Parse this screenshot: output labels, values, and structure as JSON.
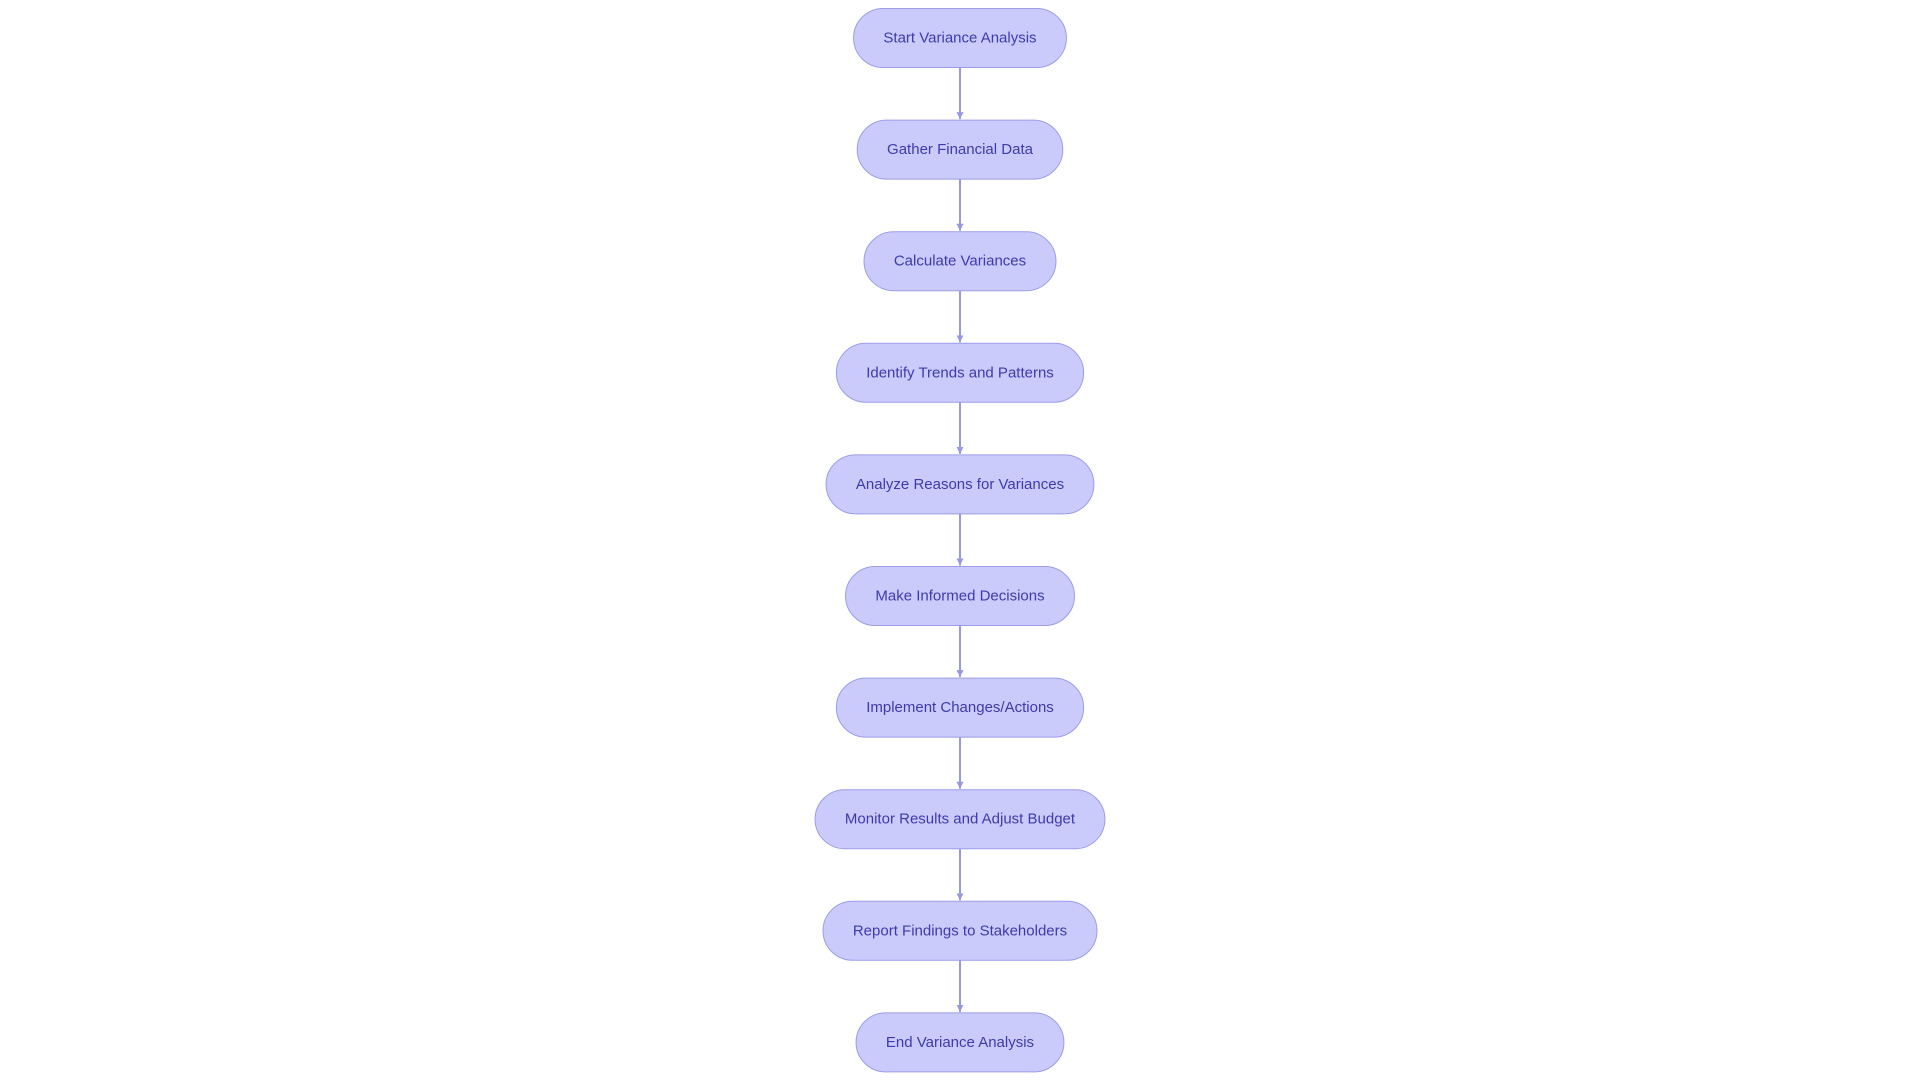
{
  "diagram": {
    "type": "flowchart",
    "direction": "top-to-bottom",
    "colors": {
      "node_fill": "#cbcbfb",
      "node_stroke": "#9c9ce8",
      "node_text": "#3b3bab",
      "edge": "#9797e6",
      "background": "#ffffff"
    },
    "nodes": [
      {
        "id": "start",
        "label": "Start Variance Analysis",
        "shape": "stadium"
      },
      {
        "id": "gather",
        "label": "Gather Financial Data",
        "shape": "stadium"
      },
      {
        "id": "calculate",
        "label": "Calculate Variances",
        "shape": "stadium"
      },
      {
        "id": "identify",
        "label": "Identify Trends and Patterns",
        "shape": "stadium"
      },
      {
        "id": "analyze",
        "label": "Analyze Reasons for Variances",
        "shape": "stadium"
      },
      {
        "id": "decide",
        "label": "Make Informed Decisions",
        "shape": "stadium"
      },
      {
        "id": "implement",
        "label": "Implement Changes/Actions",
        "shape": "stadium"
      },
      {
        "id": "monitor",
        "label": "Monitor Results and Adjust Budget",
        "shape": "stadium"
      },
      {
        "id": "report",
        "label": "Report Findings to Stakeholders",
        "shape": "stadium"
      },
      {
        "id": "end",
        "label": "End Variance Analysis",
        "shape": "stadium"
      }
    ],
    "edges": [
      {
        "from": "start",
        "to": "gather"
      },
      {
        "from": "gather",
        "to": "calculate"
      },
      {
        "from": "calculate",
        "to": "identify"
      },
      {
        "from": "identify",
        "to": "analyze"
      },
      {
        "from": "analyze",
        "to": "decide"
      },
      {
        "from": "decide",
        "to": "implement"
      },
      {
        "from": "implement",
        "to": "monitor"
      },
      {
        "from": "monitor",
        "to": "report"
      },
      {
        "from": "report",
        "to": "end"
      }
    ]
  }
}
